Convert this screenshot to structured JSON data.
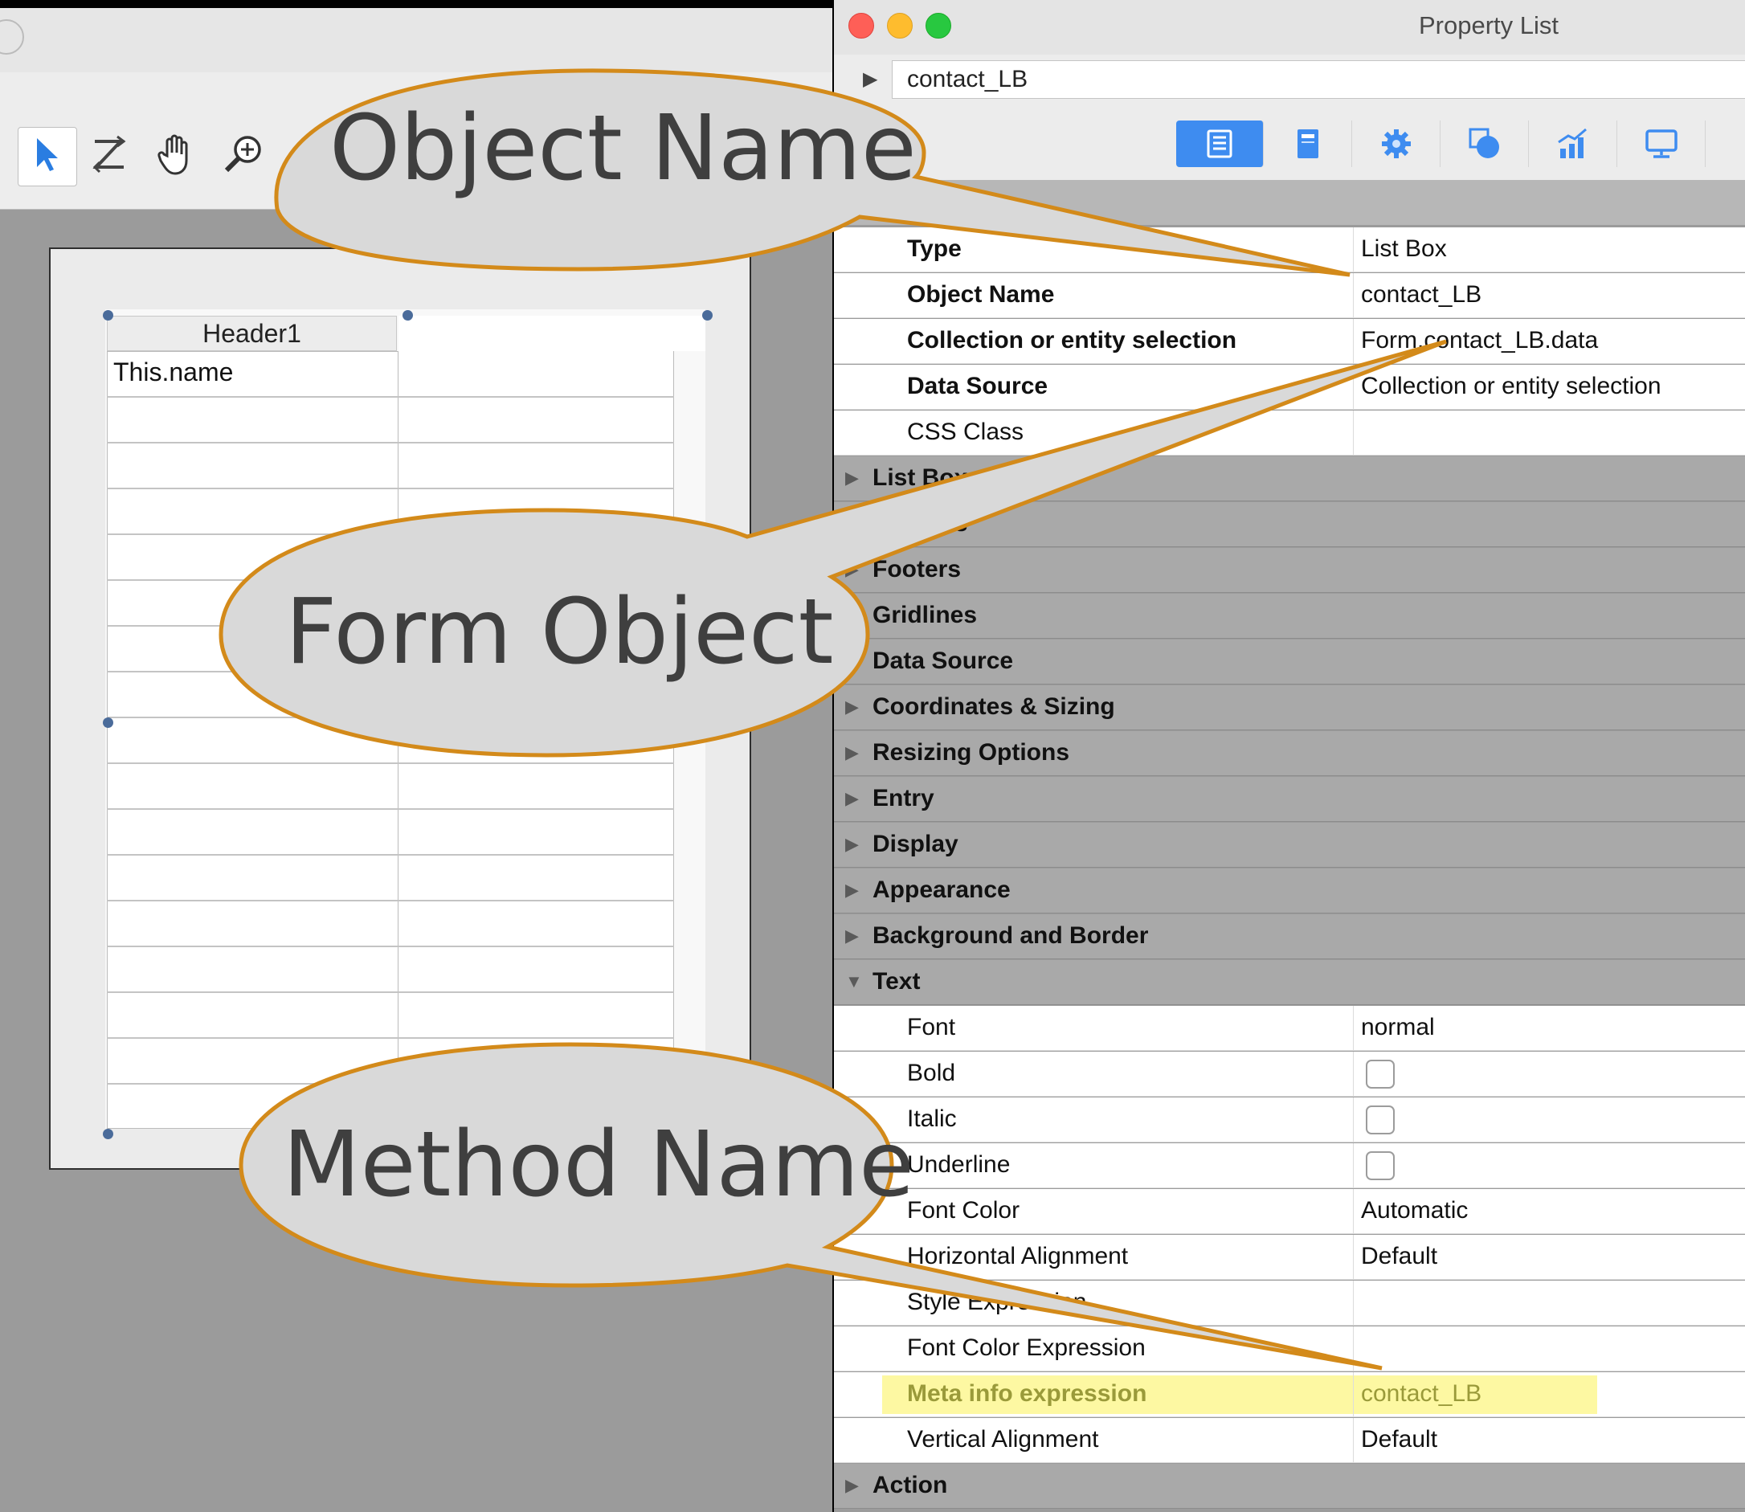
{
  "property_list": {
    "title": "Property List",
    "object_name": "contact_LB",
    "tab_icons": [
      "list-icon",
      "document-icon",
      "gear-icon",
      "shapes-icon",
      "chart-icon",
      "monitor-icon"
    ],
    "rows": [
      {
        "kind": "prop",
        "label": "Type",
        "bold": true,
        "value": "List Box"
      },
      {
        "kind": "prop",
        "label": "Object Name",
        "bold": true,
        "value": "contact_LB"
      },
      {
        "kind": "prop",
        "label": "Collection or entity selection",
        "bold": true,
        "value": "Form.contact_LB.data"
      },
      {
        "kind": "prop",
        "label": "Data Source",
        "bold": true,
        "value": "Collection or entity selection"
      },
      {
        "kind": "prop",
        "label": "CSS Class",
        "bold": false,
        "value": ""
      },
      {
        "kind": "sect",
        "label": "List Box"
      },
      {
        "kind": "sect",
        "label": "Headers"
      },
      {
        "kind": "sect",
        "label": "Footers"
      },
      {
        "kind": "sect",
        "label": "Gridlines"
      },
      {
        "kind": "sect",
        "label": "Data Source"
      },
      {
        "kind": "sect",
        "label": "Coordinates & Sizing"
      },
      {
        "kind": "sect",
        "label": "Resizing Options"
      },
      {
        "kind": "sect",
        "label": "Entry"
      },
      {
        "kind": "sect",
        "label": "Display"
      },
      {
        "kind": "sect",
        "label": "Appearance"
      },
      {
        "kind": "sect",
        "label": "Background and Border"
      },
      {
        "kind": "sect",
        "label": "Text",
        "expanded": true
      },
      {
        "kind": "prop",
        "label": "Font",
        "bold": false,
        "value": "normal"
      },
      {
        "kind": "check",
        "label": "Bold",
        "checked": false
      },
      {
        "kind": "check",
        "label": "Italic",
        "checked": false
      },
      {
        "kind": "check",
        "label": "Underline",
        "checked": false
      },
      {
        "kind": "prop",
        "label": "Font Color",
        "bold": false,
        "value": "Automatic"
      },
      {
        "kind": "prop",
        "label": "Horizontal Alignment",
        "bold": false,
        "value": "Default"
      },
      {
        "kind": "prop",
        "label": "Style Expression",
        "bold": false,
        "value": ""
      },
      {
        "kind": "prop",
        "label": "Font Color Expression",
        "bold": false,
        "value": ""
      },
      {
        "kind": "prop",
        "label": "Meta info expression",
        "bold": true,
        "value": "contact_LB",
        "highlight": true
      },
      {
        "kind": "prop",
        "label": "Vertical Alignment",
        "bold": false,
        "value": "Default"
      },
      {
        "kind": "sect",
        "label": "Action"
      }
    ]
  },
  "form_editor": {
    "toolbar_icons": [
      "arrow-pointer-icon",
      "z-order-icon",
      "hand-icon",
      "zoom-icon"
    ],
    "listbox": {
      "header": "Header1",
      "cell": "This.name"
    }
  },
  "callouts": {
    "object_name": "Object Name",
    "form_object": "Form Object",
    "method_name": "Method Name"
  },
  "colors": {
    "callout_fill": "#d9d9d9",
    "callout_border": "#d38a1a",
    "highlight": "#fdf8a2",
    "highlight_text": "#9a9a3a",
    "tab_selected": "#3e8cf0"
  }
}
